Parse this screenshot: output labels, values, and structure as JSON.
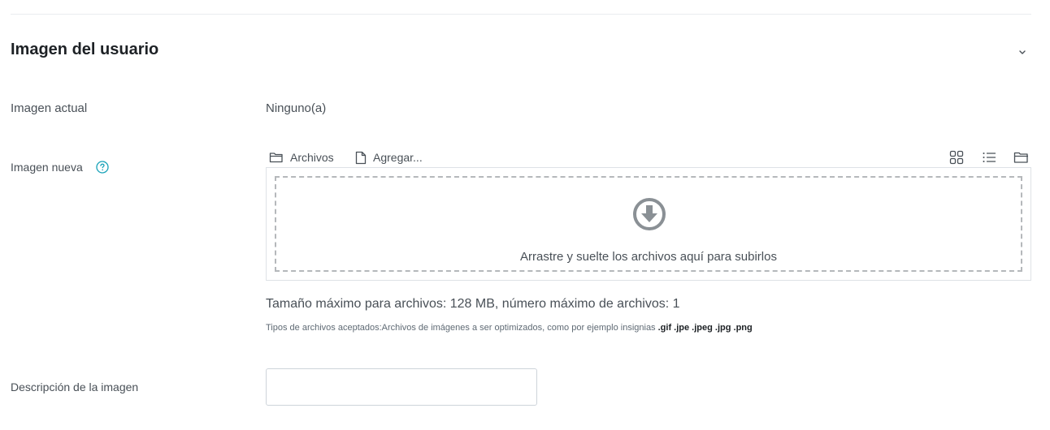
{
  "section": {
    "title": "Imagen del usuario"
  },
  "current_image": {
    "label": "Imagen actual",
    "value": "Ninguno(a)"
  },
  "new_image": {
    "label": "Imagen nueva",
    "help_icon": "question-circle-icon",
    "toolbar": {
      "files_label": "Archivos",
      "add_label": "Agregar...",
      "views": [
        "grid-view-icon",
        "list-view-icon",
        "tree-view-icon"
      ]
    },
    "dropzone_text": "Arrastre y suelte los archivos aquí para subirlos",
    "max_size_text": "Tamaño máximo para archivos: 128 MB, número máximo de archivos: 1",
    "accepted_prefix": "Tipos de archivos aceptados:Archivos de imágenes a ser optimizados, como por ejemplo insignias",
    "accepted_types": ".gif .jpe .jpeg .jpg .png"
  },
  "description": {
    "label": "Descripción de la imagen",
    "value": ""
  },
  "colors": {
    "accent": "#0f6cbf",
    "help": "#17a2b8",
    "text": "#1d2125",
    "muted": "#495057",
    "dashed_border": "#b5b8bb"
  }
}
